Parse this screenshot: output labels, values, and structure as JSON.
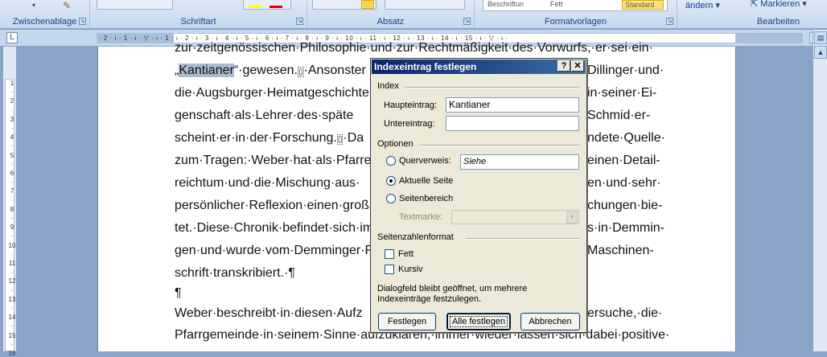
{
  "ribbon": {
    "groups": [
      "Zwischenablage",
      "Schriftart",
      "Absatz",
      "Formatvorlagen",
      "Bearbeiten"
    ],
    "styles_gallery": [
      "Beschriftun",
      "Fett",
      "Standard"
    ],
    "change_styles_label": "ändern",
    "select_label": "Markieren"
  },
  "ruler": {
    "numbers": "· 2 · ı · 1 · ı · ▽ · ı · 1 · ı · 2 · ı · 3 · ı · 4 · ı · 5 · ı · 6 · ı · 7 · ı · 8 · ı · 9 · ı · 10 · ı · 11 · ı · 12 · ı · 13 · ı · 14 · ı · 15 · ı · ▽ · ı ·",
    "vertical_numbers": [
      "1",
      "·",
      "2",
      "·",
      "3",
      "·",
      "4",
      "·",
      "5",
      "·",
      "6",
      "·",
      "7",
      "·",
      "8",
      "·",
      "9",
      "·",
      "10",
      "·",
      "11",
      "·",
      "12",
      "·",
      "13",
      "·",
      "14",
      "·",
      "15",
      "·",
      "16"
    ]
  },
  "document": {
    "lines": [
      "zur·zeitgenössischen·Philosophie·und·zur·Rechtmäßigkeit·des·Vorwurfs,·er·sei·ein·",
      "„Kantianer“·gewesen.",
      "die·Augsburger·Heimatgeschichte",
      "genschaft·als·Lehrer·des·späte",
      "scheint·er·in·der·Forschung.",
      "zum·Tragen:·Weber·hat·als·Pfarre",
      "reichtum·und·die·Mischung·aus·",
      "persönlicher·Reflexion·einen·groß",
      "tet.·Diese·Chronik·befindet·sich·im",
      "gen·und·wurde·vom·Demminger·F",
      "schrift·transkribiert.·¶",
      "¶",
      "Weber·beschreibt·in·diesen·Aufz",
      "Pfarrgemeinde·in·seinem·Sinne·aufzuklären,·immer·wieder·lassen·sich·dabei·positive·"
    ],
    "right_fragments": [
      "Dillinger·und·",
      "in·seiner·Ei-",
      "Schmid·er-",
      "ndete·Quelle·",
      "einen·Detail-",
      "en·und·sehr·",
      "chungen·bie-",
      "s·in·Demmin-",
      "Maschinen-",
      "ersuche,·die·"
    ],
    "highlighted_word": "Kantianer",
    "fragment_ansonster": "Ansonster",
    "fragment_da": "Da"
  },
  "dialog": {
    "title": "Indexeintrag festlegen",
    "help_label": "?",
    "close_label": "✕",
    "index_section": "Index",
    "main_entry_label": "Haupteintrag:",
    "main_entry_value": "Kantianer",
    "sub_entry_label": "Untereintrag:",
    "sub_entry_value": "",
    "options_section": "Optionen",
    "cross_ref_label": "Querverweis:",
    "cross_ref_value": "Siehe",
    "current_page_label": "Aktuelle Seite",
    "page_range_label": "Seitenbereich",
    "bookmark_label": "Textmarke:",
    "page_format_section": "Seitenzahlenformat",
    "bold_label": "Fett",
    "italic_label": "Kursiv",
    "info_text": "Dialogfeld bleibt geöffnet, um mehrere Indexeinträge festzulegen.",
    "btn_mark": "Festlegen",
    "btn_mark_all": "Alle festlegen",
    "btn_cancel": "Abbrechen",
    "selected_option": "current_page"
  }
}
